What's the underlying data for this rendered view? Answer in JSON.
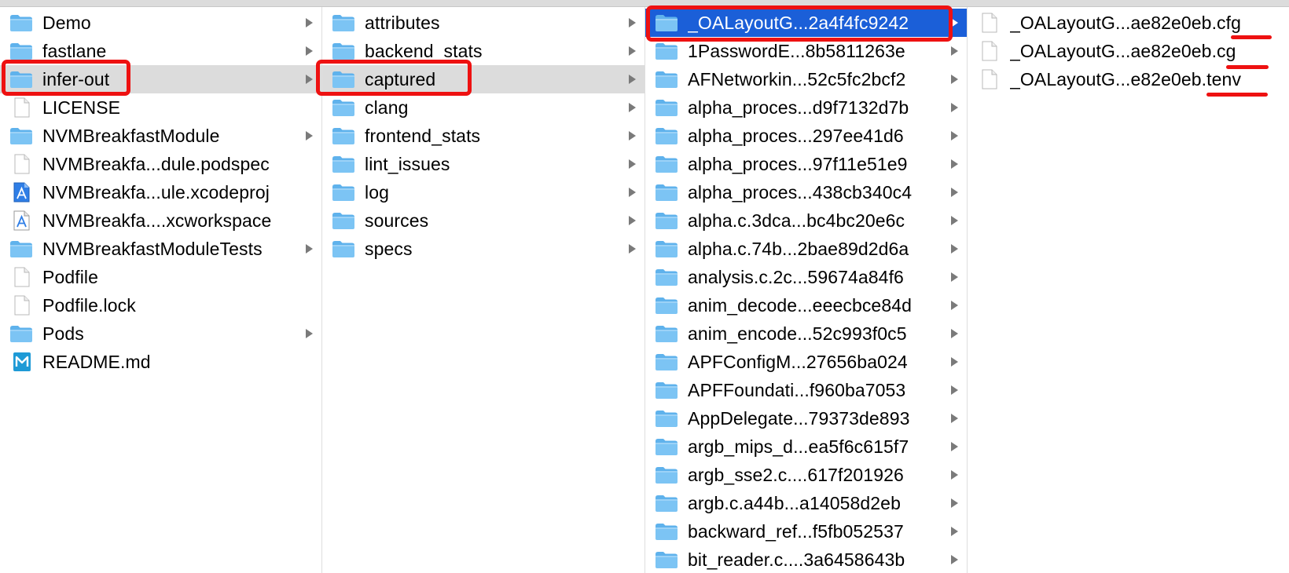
{
  "columns": [
    {
      "items": [
        {
          "label": "Demo",
          "icon": "folder-icon",
          "kind": "folder",
          "arrow": true
        },
        {
          "label": "fastlane",
          "icon": "folder-icon",
          "kind": "folder",
          "arrow": true
        },
        {
          "label": "infer-out",
          "icon": "folder-icon",
          "kind": "folder",
          "arrow": true,
          "state": "path-selected"
        },
        {
          "label": "LICENSE",
          "icon": "document-icon",
          "kind": "file",
          "arrow": false
        },
        {
          "label": "NVMBreakfastModule",
          "icon": "folder-icon",
          "kind": "folder",
          "arrow": true
        },
        {
          "label": "NVMBreakfa...dule.podspec",
          "icon": "document-icon",
          "kind": "file",
          "arrow": false
        },
        {
          "label": "NVMBreakfa...ule.xcodeproj",
          "icon": "xcodeproj-icon",
          "kind": "xcode",
          "arrow": false
        },
        {
          "label": "NVMBreakfa....xcworkspace",
          "icon": "xcworkspace-icon",
          "kind": "workspace",
          "arrow": false
        },
        {
          "label": "NVMBreakfastModuleTests",
          "icon": "folder-icon",
          "kind": "folder",
          "arrow": true
        },
        {
          "label": "Podfile",
          "icon": "document-icon",
          "kind": "file",
          "arrow": false
        },
        {
          "label": "Podfile.lock",
          "icon": "document-icon",
          "kind": "file",
          "arrow": false
        },
        {
          "label": "Pods",
          "icon": "folder-icon",
          "kind": "folder",
          "arrow": true
        },
        {
          "label": "README.md",
          "icon": "markdown-icon",
          "kind": "markdown",
          "arrow": false
        }
      ]
    },
    {
      "items": [
        {
          "label": "attributes",
          "icon": "folder-icon",
          "kind": "folder",
          "arrow": true
        },
        {
          "label": "backend_stats",
          "icon": "folder-icon",
          "kind": "folder",
          "arrow": true
        },
        {
          "label": "captured",
          "icon": "folder-icon",
          "kind": "folder",
          "arrow": true,
          "state": "path-selected"
        },
        {
          "label": "clang",
          "icon": "folder-icon",
          "kind": "folder",
          "arrow": true
        },
        {
          "label": "frontend_stats",
          "icon": "folder-icon",
          "kind": "folder",
          "arrow": true
        },
        {
          "label": "lint_issues",
          "icon": "folder-icon",
          "kind": "folder",
          "arrow": true
        },
        {
          "label": "log",
          "icon": "folder-icon",
          "kind": "folder",
          "arrow": true
        },
        {
          "label": "sources",
          "icon": "folder-icon",
          "kind": "folder",
          "arrow": true
        },
        {
          "label": "specs",
          "icon": "folder-icon",
          "kind": "folder",
          "arrow": true
        }
      ]
    },
    {
      "items": [
        {
          "label": "_OALayoutG...2a4f4fc9242",
          "icon": "folder-icon",
          "kind": "folder",
          "arrow": true,
          "state": "active-selected"
        },
        {
          "label": "1PasswordE...8b5811263e",
          "icon": "folder-icon",
          "kind": "folder",
          "arrow": true
        },
        {
          "label": "AFNetworkin...52c5fc2bcf2",
          "icon": "folder-icon",
          "kind": "folder",
          "arrow": true
        },
        {
          "label": "alpha_proces...d9f7132d7b",
          "icon": "folder-icon",
          "kind": "folder",
          "arrow": true
        },
        {
          "label": "alpha_proces...297ee41d6",
          "icon": "folder-icon",
          "kind": "folder",
          "arrow": true
        },
        {
          "label": "alpha_proces...97f11e51e9",
          "icon": "folder-icon",
          "kind": "folder",
          "arrow": true
        },
        {
          "label": "alpha_proces...438cb340c4",
          "icon": "folder-icon",
          "kind": "folder",
          "arrow": true
        },
        {
          "label": "alpha.c.3dca...bc4bc20e6c",
          "icon": "folder-icon",
          "kind": "folder",
          "arrow": true
        },
        {
          "label": "alpha.c.74b...2bae89d2d6a",
          "icon": "folder-icon",
          "kind": "folder",
          "arrow": true
        },
        {
          "label": "analysis.c.2c...59674a84f6",
          "icon": "folder-icon",
          "kind": "folder",
          "arrow": true
        },
        {
          "label": "anim_decode...eeecbce84d",
          "icon": "folder-icon",
          "kind": "folder",
          "arrow": true
        },
        {
          "label": "anim_encode...52c993f0c5",
          "icon": "folder-icon",
          "kind": "folder",
          "arrow": true
        },
        {
          "label": "APFConfigM...27656ba024",
          "icon": "folder-icon",
          "kind": "folder",
          "arrow": true
        },
        {
          "label": "APFFoundati...f960ba7053",
          "icon": "folder-icon",
          "kind": "folder",
          "arrow": true
        },
        {
          "label": "AppDelegate...79373de893",
          "icon": "folder-icon",
          "kind": "folder",
          "arrow": true
        },
        {
          "label": "argb_mips_d...ea5f6c615f7",
          "icon": "folder-icon",
          "kind": "folder",
          "arrow": true
        },
        {
          "label": "argb_sse2.c....617f201926",
          "icon": "folder-icon",
          "kind": "folder",
          "arrow": true
        },
        {
          "label": "argb.c.a44b...a14058d2eb",
          "icon": "folder-icon",
          "kind": "folder",
          "arrow": true
        },
        {
          "label": "backward_ref...f5fb052537",
          "icon": "folder-icon",
          "kind": "folder",
          "arrow": true
        },
        {
          "label": "bit_reader.c....3a6458643b",
          "icon": "folder-icon",
          "kind": "folder",
          "arrow": true
        }
      ]
    },
    {
      "items": [
        {
          "label": "_OALayoutG...ae82e0eb.cfg",
          "icon": "document-icon",
          "kind": "file",
          "arrow": false
        },
        {
          "label": "_OALayoutG...ae82e0eb.cg",
          "icon": "document-icon",
          "kind": "file",
          "arrow": false
        },
        {
          "label": "_OALayoutG...e82e0eb.tenv",
          "icon": "document-icon",
          "kind": "file",
          "arrow": false
        }
      ]
    }
  ],
  "colors": {
    "folder": "#7cc4f4",
    "folder_tab": "#5fb2ec",
    "path_selection": "#dcdcdc",
    "active_selection": "#1b5fd8",
    "annotation": "#ee1111"
  }
}
